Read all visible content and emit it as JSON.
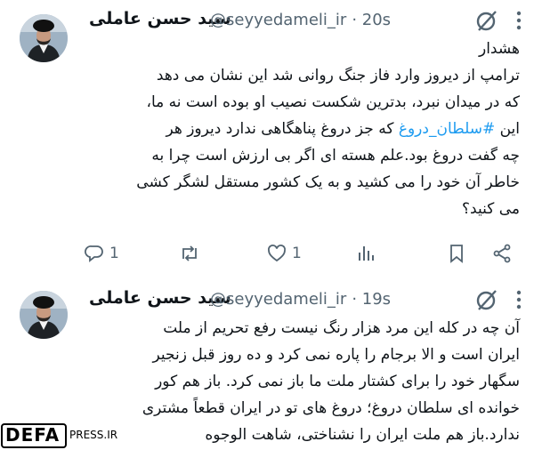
{
  "tweets": [
    {
      "author_name": "سید حسن عاملی",
      "handle": "@seyyedameli_ir",
      "time": "· 20s",
      "lines": [
        "هشدار",
        "ترامپ از دیروز وارد فاز جنگ روانی شد این نشان می دهد",
        "که در میدان نبرد، بدترین شکست نصیب او بوده است نه ما،",
        "این #سلطان_دروغ که جز دروغ پناهگاهی ندارد دیروز هر",
        "چه گفت دروغ بود.علم هسته ای اگر بی ارزش است چرا به",
        "خاطر آن خود را می کشید و به یک کشور مستقل لشگر کشی",
        "می کنید؟"
      ],
      "hashtag": "#سلطان_دروغ",
      "reply_count": "1",
      "like_count": "1",
      "icons": [
        "reply-icon",
        "retweet-icon",
        "like-icon",
        "views-icon",
        "bookmark-icon",
        "share-icon"
      ]
    },
    {
      "author_name": "سید حسن عاملی",
      "handle": "@seyyedameli_ir",
      "time": "· 19s",
      "lines": [
        "آن چه در کله این مرد هزار رنگ نیست رفع تحریم از ملت",
        "ایران است و الا برجام را پاره نمی کرد و ده روز قبل زنجیر",
        "سگهار خود را برای کشتار ملت ما باز نمی کرد. باز هم کور",
        "خوانده ای سلطان دروغ؛ دروغ های تو در ایران قطعاً مشتری",
        "ندارد.باز هم ملت ایران را نشناختی، شاهت الوجوه"
      ]
    }
  ],
  "watermark": {
    "defa": "DEFA",
    "press": "PRESS.IR"
  },
  "colors": {
    "text": "#0f1419",
    "muted": "#536471",
    "link": "#1d9bf0",
    "background": "#ffffff"
  }
}
